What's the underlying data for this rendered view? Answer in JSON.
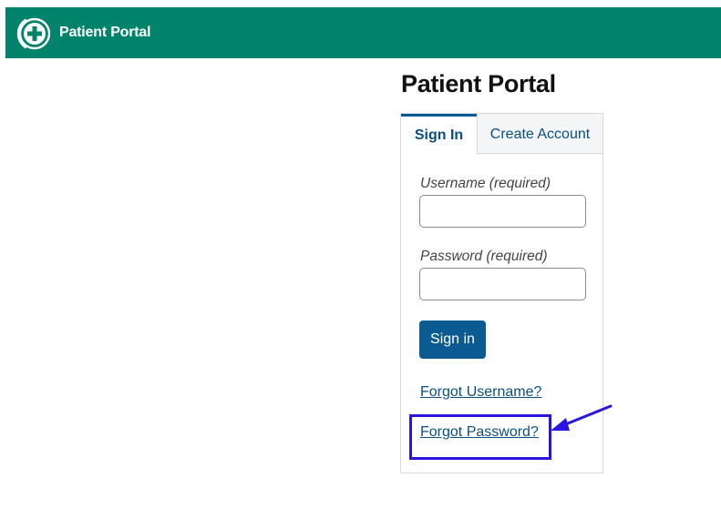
{
  "header": {
    "brand": "Patient Portal",
    "logo_icon": "plus-circle-logo-icon",
    "background_color": "#00836a"
  },
  "page": {
    "title": "Patient Portal"
  },
  "tabs": [
    {
      "label": "Sign In",
      "active": true
    },
    {
      "label": "Create Account",
      "active": false
    }
  ],
  "form": {
    "username_label": "Username (required)",
    "username_value": "",
    "password_label": "Password (required)",
    "password_value": "",
    "submit_label": "Sign in"
  },
  "links": {
    "forgot_username": "Forgot Username?",
    "forgot_password": "Forgot Password?"
  },
  "annotation": {
    "highlight_color": "#2b14e0",
    "arrow_icon": "arrow-icon"
  },
  "colors": {
    "primary": "#0b5a91",
    "link": "#0a4f84"
  }
}
